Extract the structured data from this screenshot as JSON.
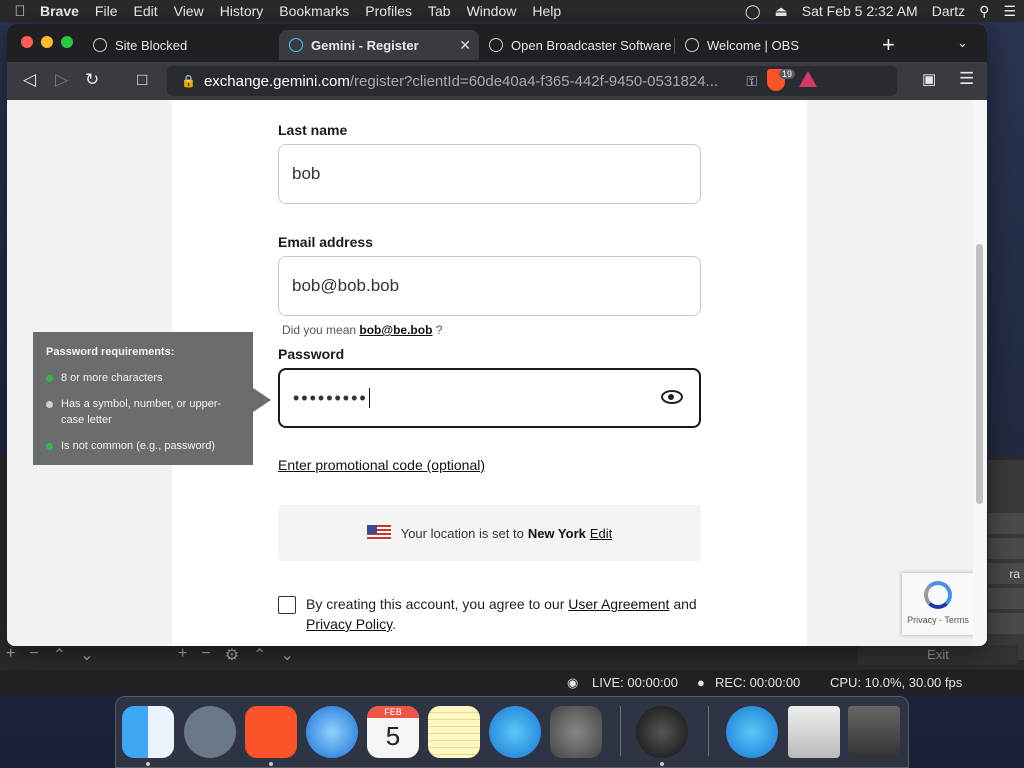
{
  "menubar": {
    "app_name": "Brave",
    "items": [
      "File",
      "Edit",
      "View",
      "History",
      "Bookmarks",
      "Profiles",
      "Tab",
      "Window",
      "Help"
    ],
    "clock": "Sat Feb 5  2:32 AM",
    "user": "Dartz"
  },
  "tabs": [
    {
      "label": "Site Blocked"
    },
    {
      "label": "Gemini - Register"
    },
    {
      "label": "Open Broadcaster Software"
    },
    {
      "label": "Welcome | OBS"
    }
  ],
  "address": {
    "host": "exchange.gemini.com",
    "path": "/register?clientId=60de40a4-f365-442f-9450-0531824..."
  },
  "shield_count": "19",
  "form": {
    "last_name_label": "Last name",
    "last_name_value": "bob",
    "email_label": "Email address",
    "email_value": "bob@bob.bob",
    "did_you_mean_prefix": "Did you mean",
    "did_you_mean_suggestion": "bob@be.bob",
    "did_you_mean_suffix": "?",
    "password_label": "Password",
    "password_value": "•••••••••",
    "promo_link": "Enter promotional code (optional)",
    "location_prefix": "Your location is set to",
    "location_city": "New York",
    "location_edit": "Edit",
    "agree_prefix": "By creating this account, you agree to our",
    "user_agreement": "User Agreement",
    "agree_and": "and",
    "privacy_policy": "Privacy Policy",
    "agree_suffix": "."
  },
  "tooltip": {
    "title": "Password requirements:",
    "requirements": [
      {
        "text": "8 or more characters",
        "met": true
      },
      {
        "text": "Has a symbol, number, or upper-case letter",
        "met": false
      },
      {
        "text": "Is not common (e.g., password)",
        "met": true
      }
    ]
  },
  "recaptcha": {
    "links": "Privacy - Terms"
  },
  "obs": {
    "live": "LIVE: 00:00:00",
    "rec": "REC: 00:00:00",
    "cpu": "CPU: 10.0%, 30.00 fps",
    "exit": "Exit",
    "side_fragment": "ra"
  },
  "dock": {
    "calendar_month": "FEB",
    "calendar_day": "5",
    "apps": [
      "finder-icon",
      "launchpad-icon",
      "brave-icon",
      "safari-icon",
      "calendar-icon",
      "notes-icon",
      "app-store-icon",
      "system-preferences-icon",
      "obs-icon",
      "app-store-icon",
      "downloads-icon",
      "trash-icon"
    ]
  },
  "colors": {
    "met": "#39b44a",
    "unmet": "#d0d0d0",
    "brave": "#fb542b"
  }
}
